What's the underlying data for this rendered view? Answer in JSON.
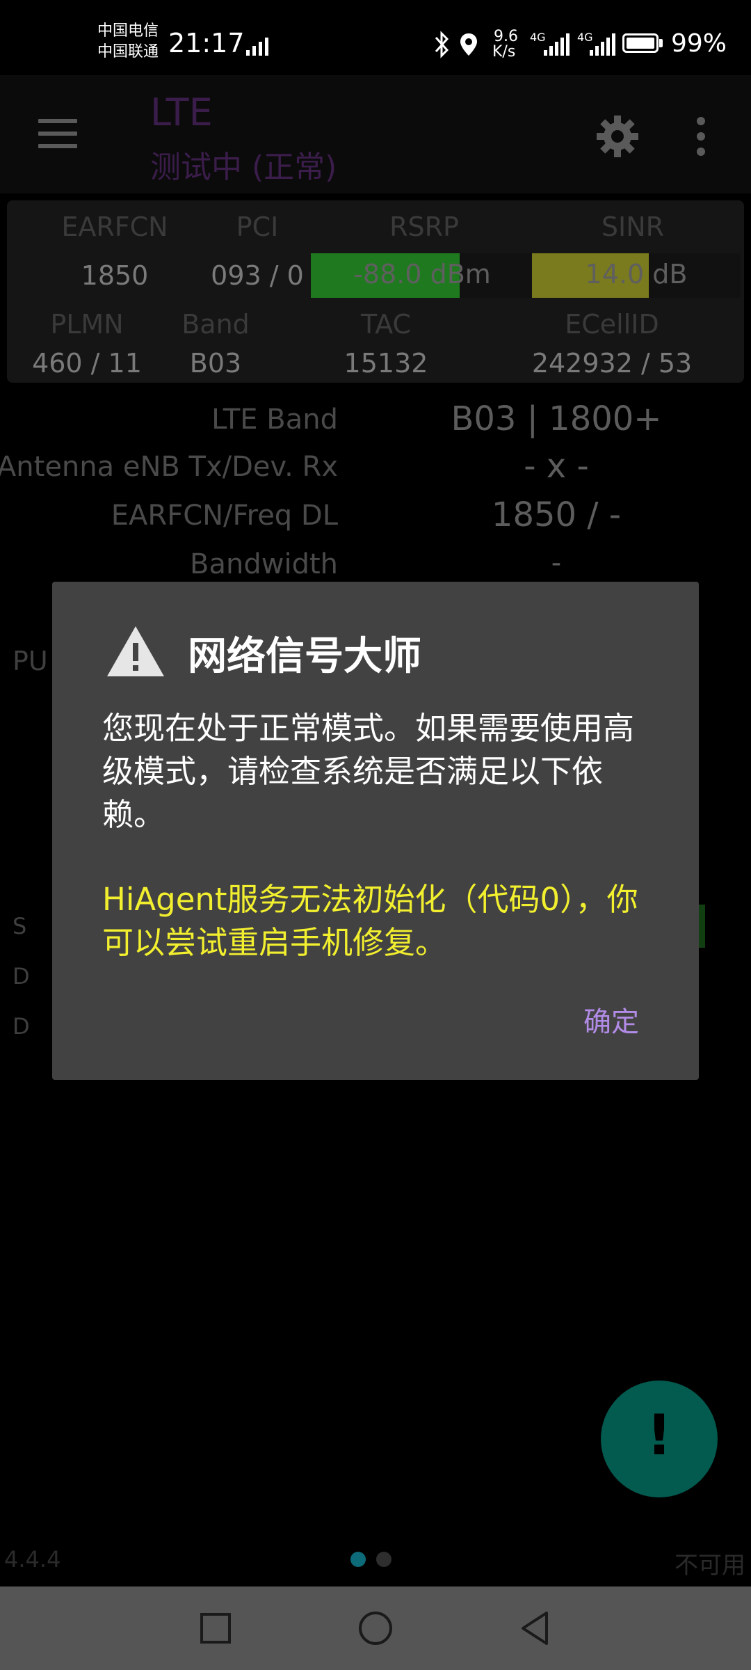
{
  "status_bar": {
    "carrier1": "中国电信",
    "carrier2": "中国联通",
    "time": "21:17",
    "speed_value": "9.6",
    "speed_unit": "K/s",
    "net1": "4G",
    "net2": "4G",
    "battery": "99%"
  },
  "toolbar": {
    "title": "LTE",
    "subtitle": "测试中 (正常)"
  },
  "panel": {
    "headers": [
      "EARFCN",
      "PCI",
      "RSRP",
      "SINR"
    ],
    "values": {
      "earfcn": "1850",
      "pci": "093 / 0",
      "rsrp": "-88.0 dBm",
      "sinr": "14.0 dB"
    },
    "rsrp_level": 0.67,
    "sinr_level": 0.56,
    "headers2": [
      "PLMN",
      "Band",
      "TAC",
      "ECellID"
    ],
    "values2": {
      "plmn": "460 / 11",
      "band": "B03",
      "tac": "15132",
      "ecellid": "242932 / 53"
    }
  },
  "details": [
    {
      "label": "LTE Band",
      "value": "B03 | 1800+"
    },
    {
      "label": "Antenna eNB Tx/Dev. Rx",
      "value": "- x -"
    },
    {
      "label": "EARFCN/Freq DL",
      "value": "1850 / -"
    },
    {
      "label": "Bandwidth",
      "value": "-"
    }
  ],
  "side_labels": {
    "pu": "PU",
    "s": "S",
    "d1": "D",
    "d2": "D"
  },
  "dialog": {
    "title": "网络信号大师",
    "body": "您现在处于正常模式。如果需要使用高级模式，请检查系统是否满足以下依赖。",
    "warning": "HiAgent服务无法初始化（代码0），你可以尝试重启手机修复。",
    "ok": "确定"
  },
  "fab": {
    "mark": "!"
  },
  "footer": {
    "version": "4.4.4",
    "status": "不可用"
  },
  "colors": {
    "rsrp_bar": "#1f7a1f",
    "sinr_bar": "#7a7a1e",
    "dialog_bg": "#424242",
    "warning_text": "#f2ef2f",
    "accent": "#b18be6",
    "fab": "#035a4f"
  }
}
